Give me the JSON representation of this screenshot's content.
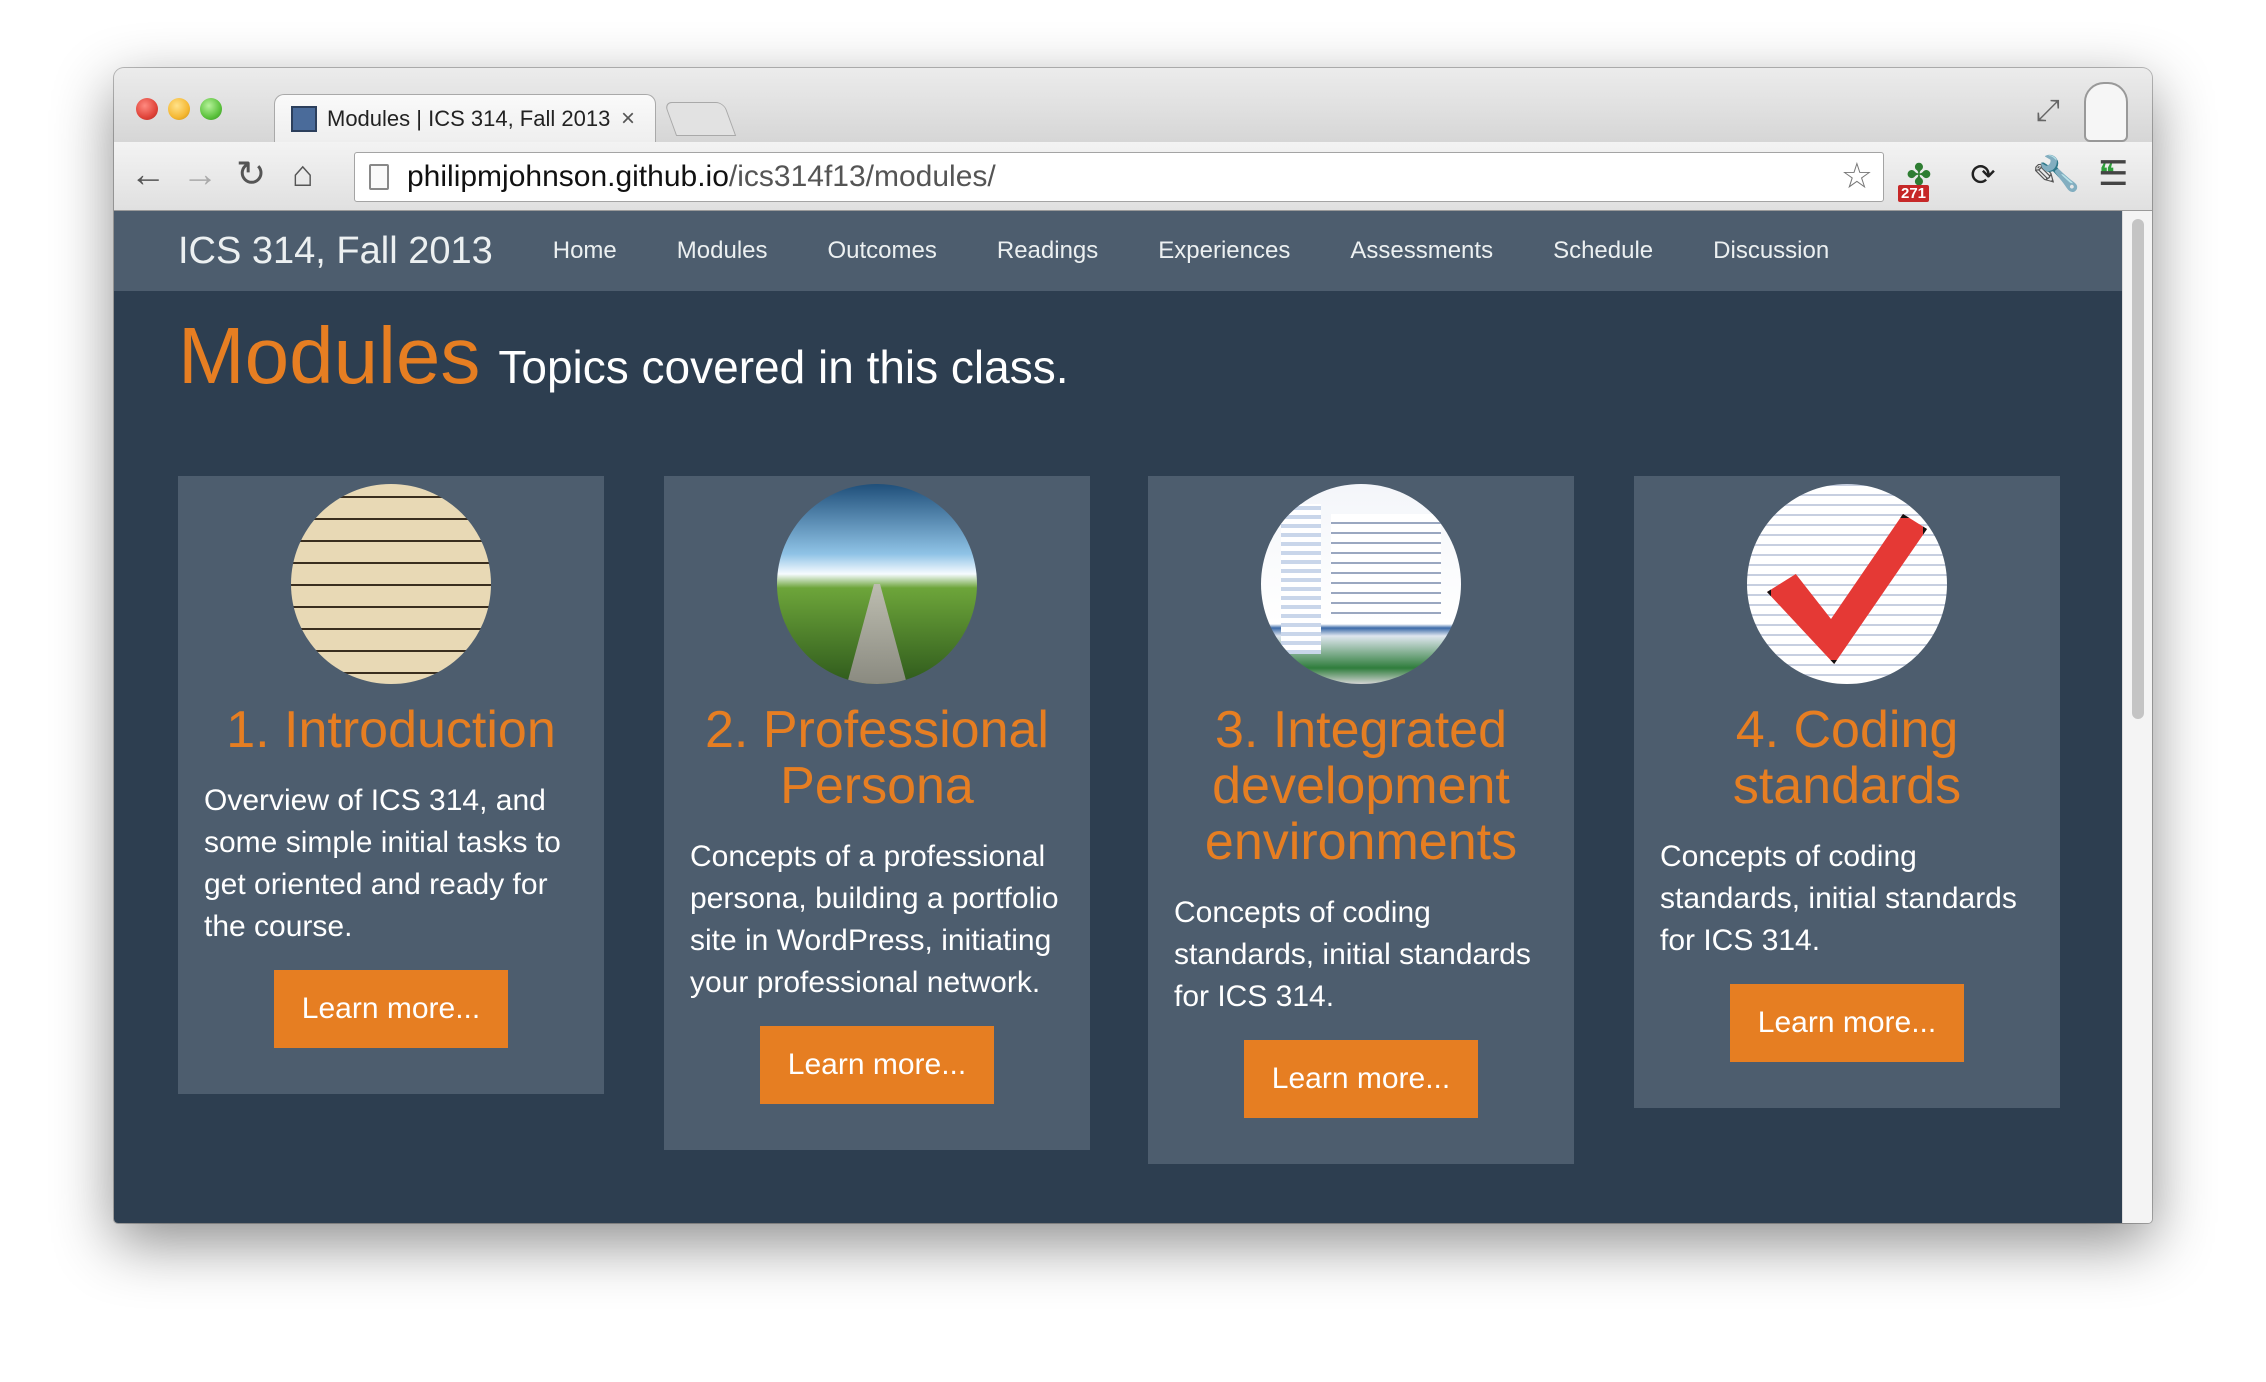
{
  "browser": {
    "tab_title": "Modules | ICS 314, Fall 2013",
    "tab_close": "×",
    "url_host": "philipmjohnson.github.io",
    "url_path": "/ics314f13/modules/",
    "extension_badge": "271",
    "icons": [
      "back-icon",
      "forward-icon",
      "reload-icon",
      "home-icon",
      "bookmark-star-icon",
      "fullscreen-icon",
      "menu-icon"
    ]
  },
  "site": {
    "brand": "ICS 314, Fall 2013",
    "nav": [
      "Home",
      "Modules",
      "Outcomes",
      "Readings",
      "Experiences",
      "Assessments",
      "Schedule",
      "Discussion"
    ]
  },
  "page": {
    "title": "Modules",
    "subtitle": "Topics covered in this class."
  },
  "modules": [
    {
      "title": "1. Introduction",
      "text": "Overview of ICS 314, and some simple initial tasks to get oriented and ready for the course.",
      "button": "Learn more..."
    },
    {
      "title": "2. Professional Persona",
      "text": "Concepts of a professional persona, building a portfolio site in WordPress, initiating your professional network.",
      "button": "Learn more..."
    },
    {
      "title": "3. Integrated development environments",
      "text": "Concepts of coding standards, initial standards for ICS 314.",
      "button": "Learn more..."
    },
    {
      "title": "4. Coding standards",
      "text": "Concepts of coding standards, initial standards for ICS 314.",
      "button": "Learn more..."
    }
  ],
  "colors": {
    "accent": "#e67e22",
    "background": "#2d3e50",
    "card": "#4d5d6e"
  }
}
